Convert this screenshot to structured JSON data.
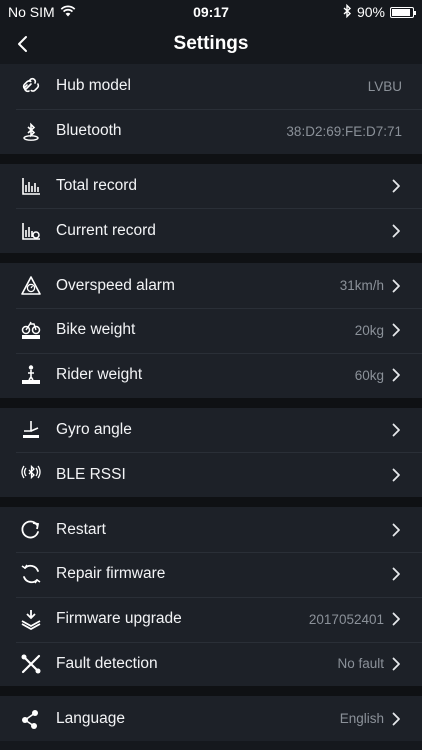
{
  "status": {
    "carrier": "No SIM",
    "time": "09:17",
    "battery": "90%",
    "battery_level": 0.9
  },
  "nav": {
    "title": "Settings"
  },
  "groups": [
    {
      "items": [
        {
          "icon": "link-icon",
          "label": "Hub model",
          "value": "LVBU",
          "chevron": false
        },
        {
          "icon": "bluetooth-icon",
          "label": "Bluetooth",
          "value": "38:D2:69:FE:D7:71",
          "chevron": false
        }
      ]
    },
    {
      "items": [
        {
          "icon": "total-record-icon",
          "label": "Total record",
          "value": "",
          "chevron": true
        },
        {
          "icon": "current-record-icon",
          "label": "Current record",
          "value": "",
          "chevron": true
        }
      ]
    },
    {
      "items": [
        {
          "icon": "overspeed-alarm-icon",
          "label": "Overspeed alarm",
          "value": "31km/h",
          "chevron": true
        },
        {
          "icon": "bike-weight-icon",
          "label": "Bike weight",
          "value": "20kg",
          "chevron": true
        },
        {
          "icon": "rider-weight-icon",
          "label": "Rider weight",
          "value": "60kg",
          "chevron": true
        }
      ]
    },
    {
      "items": [
        {
          "icon": "gyro-angle-icon",
          "label": "Gyro angle",
          "value": "",
          "chevron": true
        },
        {
          "icon": "ble-rssi-icon",
          "label": "BLE RSSI",
          "value": "",
          "chevron": true
        }
      ]
    },
    {
      "items": [
        {
          "icon": "restart-icon",
          "label": "Restart",
          "value": "",
          "chevron": true
        },
        {
          "icon": "repair-firmware-icon",
          "label": "Repair firmware",
          "value": "",
          "chevron": true
        },
        {
          "icon": "firmware-upgrade-icon",
          "label": "Firmware upgrade",
          "value": "2017052401",
          "chevron": true
        },
        {
          "icon": "fault-detection-icon",
          "label": "Fault detection",
          "value": "No fault",
          "chevron": true
        }
      ]
    },
    {
      "items": [
        {
          "icon": "language-icon",
          "label": "Language",
          "value": "English",
          "chevron": true
        }
      ]
    }
  ]
}
